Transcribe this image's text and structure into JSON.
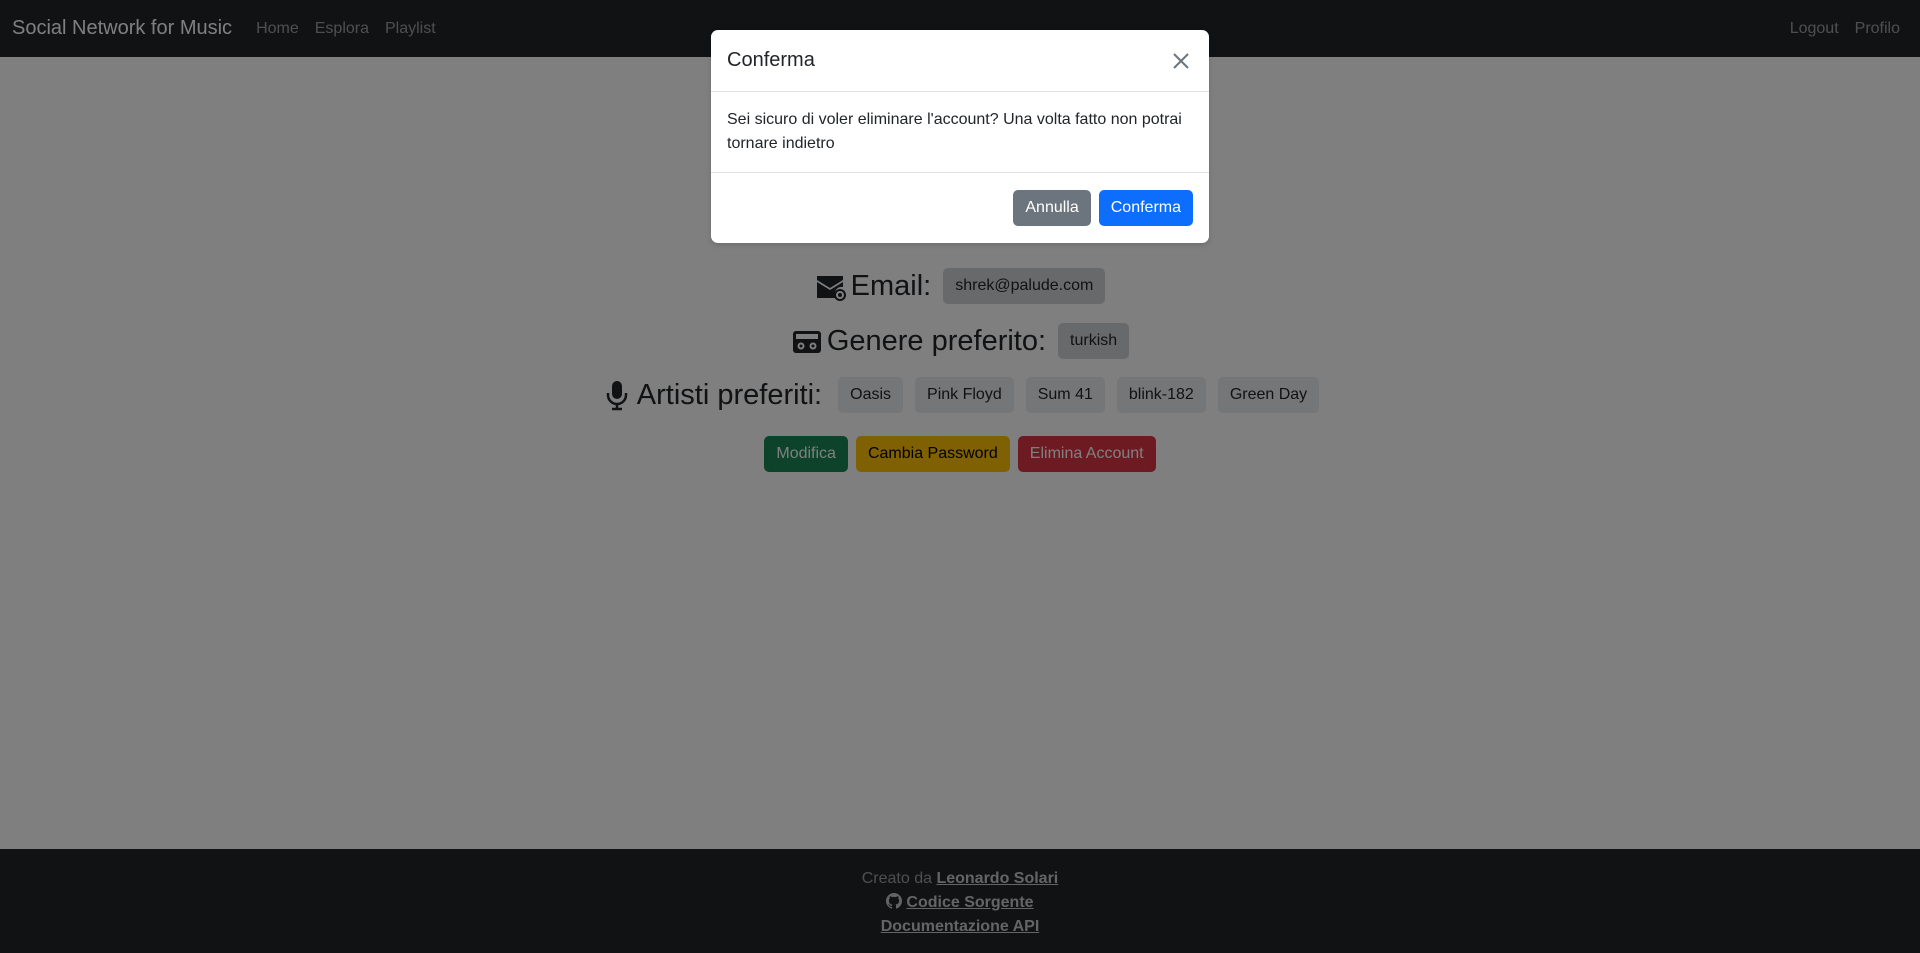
{
  "navbar": {
    "brand": "Social Network for Music",
    "links": [
      "Home",
      "Esplora",
      "Playlist"
    ],
    "right_links": [
      "Logout",
      "Profilo"
    ]
  },
  "profile": {
    "email_label": "Email:",
    "email_value": "shrek@palude.com",
    "genre_label": "Genere preferito:",
    "genre_value": "turkish",
    "artists_label": "Artisti preferiti:",
    "artists": [
      "Oasis",
      "Pink Floyd",
      "Sum 41",
      "blink-182",
      "Green Day"
    ],
    "buttons": {
      "edit": "Modifica",
      "change_password": "Cambia Password",
      "delete_account": "Elimina Account"
    }
  },
  "footer": {
    "created_by_prefix": "Creato da",
    "author": "Leonardo Solari",
    "source_code": "Codice Sorgente",
    "api_docs": "Documentazione API"
  },
  "modal": {
    "title": "Conferma",
    "body": "Sei sicuro di voler eliminare l'account? Una volta fatto non potrai tornare indietro",
    "cancel_label": "Annulla",
    "confirm_label": "Conferma"
  },
  "colors": {
    "navbar_bg": "#212529",
    "backdrop": "rgba(0,0,0,0.5)",
    "success": "#198754",
    "warning": "#ffc107",
    "danger": "#dc3545",
    "secondary": "#6c757d",
    "primary": "#0d6efd"
  }
}
